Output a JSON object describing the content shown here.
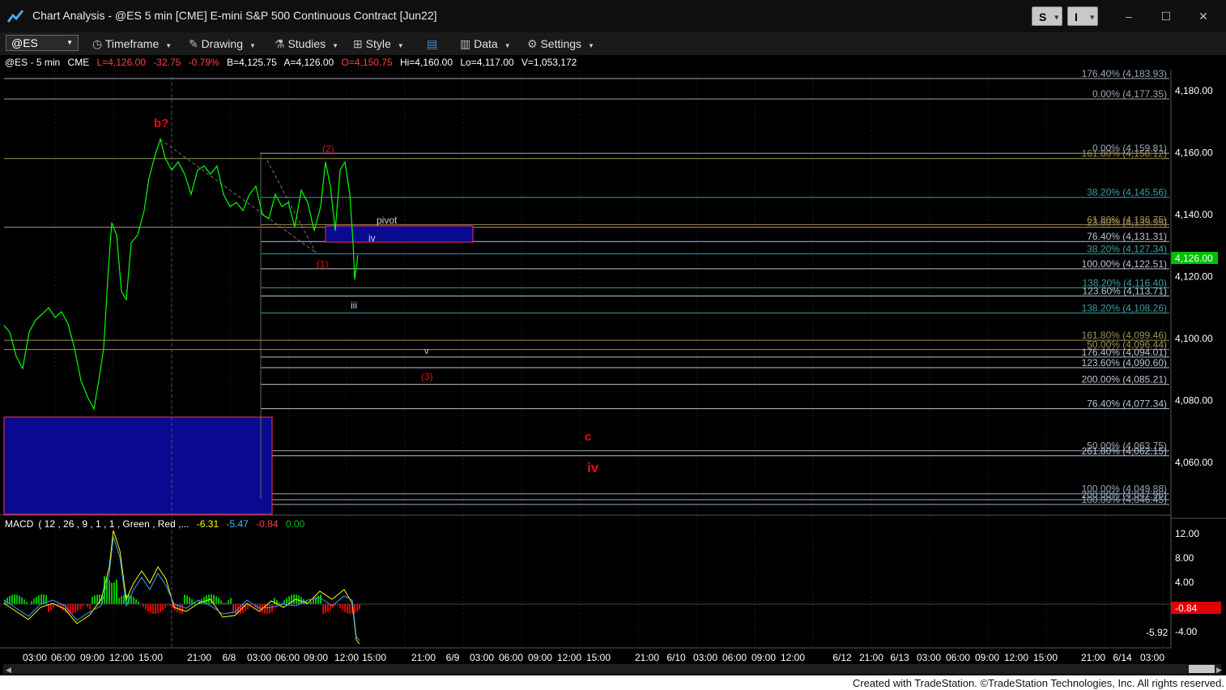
{
  "window": {
    "title": "Chart Analysis - @ES 5 min [CME] E-mini S&P 500 Continuous Contract [Jun22]",
    "btn_s": "S",
    "btn_i": "I",
    "minimize_icon": "minimize-icon",
    "maximize_icon": "maximize-icon",
    "close_icon": "close-icon"
  },
  "toolbar": {
    "symbol": "@ES",
    "timeframe": "Timeframe",
    "drawing": "Drawing",
    "studies": "Studies",
    "style": "Style",
    "data": "Data",
    "settings": "Settings"
  },
  "info": {
    "symbol": "@ES - 5 min",
    "exchange": "CME",
    "last": "L=4,126.00",
    "change": "-32.75",
    "pct": "-0.79%",
    "bid": "B=4,125.75",
    "ask": "A=4,126.00",
    "open": "O=4,150.75",
    "high": "Hi=4,160.00",
    "low": "Lo=4,117.00",
    "volume": "V=1,053,172"
  },
  "price_axis": {
    "labels": [
      "4,180.00",
      "4,160.00",
      "4,140.00",
      "4,120.00",
      "4,100.00",
      "4,080.00",
      "4,060.00"
    ],
    "current": "4,126.00",
    "current_color": "#00c000"
  },
  "fib_levels": [
    {
      "label": "176.40% (4,183.93)",
      "color": "#9aa8b8"
    },
    {
      "label": "0.00% (4,177.35)",
      "color": "#9aa8b8"
    },
    {
      "label": "0.00% (4,159.81)",
      "color": "#9aa8b8"
    },
    {
      "label": "161.80% (4,158.12)",
      "color": "#a09050"
    },
    {
      "label": "38.20% (4,145.56)",
      "color": "#3a9ea0"
    },
    {
      "label": "61.80% (4,136.75)",
      "color": "#a09050"
    },
    {
      "label": "23.60% (4,135.95)",
      "color": "#a09050"
    },
    {
      "label": "76.40% (4,131.31)",
      "color": "#b8c4d0"
    },
    {
      "label": "38.20% (4,127.34)",
      "color": "#3a9ea0"
    },
    {
      "label": "100.00% (4,122.51)",
      "color": "#b8c4d0"
    },
    {
      "label": "138.20% (4,116.40)",
      "color": "#3a9ea0"
    },
    {
      "label": "123.60% (4,113.71)",
      "color": "#b8c4d0"
    },
    {
      "label": "138.20% (4,108.26)",
      "color": "#3a9ea0"
    },
    {
      "label": "161.80% (4,099.46)",
      "color": "#a09050"
    },
    {
      "label": "50.00% (4,096.44)",
      "color": "#a09050"
    },
    {
      "label": "176.40% (4,094.01)",
      "color": "#b8c4d0"
    },
    {
      "label": "123.60% (4,090.60)",
      "color": "#b8c4d0"
    },
    {
      "label": "200.00% (4,085.21)",
      "color": "#b8c4d0"
    },
    {
      "label": "76.40% (4,077.34)",
      "color": "#b8c4d0"
    },
    {
      "label": "50.00% (4,063.75)",
      "color": "#9aa8b8"
    },
    {
      "label": "261.80% (4,062.15)",
      "color": "#b8c4d0"
    },
    {
      "label": "100.00% (4,049.88)",
      "color": "#9aa8b8"
    },
    {
      "label": "200.00% (4,047.96)",
      "color": "#9aa8b8"
    },
    {
      "label": "100.00% (4,046.45)",
      "color": "#9aa8b8"
    }
  ],
  "annotations": {
    "b": "b?",
    "w1": "(1)",
    "w2": "(2)",
    "w3": "(3)",
    "pivot": "pivot",
    "iv_small": "iv",
    "iii": "iii",
    "v": "v",
    "c": "c",
    "iv_big": "iv"
  },
  "macd": {
    "name": "MACD",
    "params": "( 12 , 26 , 9 , 1 , 1 , Green , Red ,...",
    "v1": "-6.31",
    "v2": "-5.47",
    "v3": "-0.84",
    "v4": "0.00",
    "axis": [
      "12.00",
      "8.00",
      "4.00",
      "-4.00"
    ],
    "current": "-0.84",
    "signal_value": "-5.92"
  },
  "time_axis": [
    "03:00",
    "06:00",
    "09:00",
    "12:00",
    "15:00",
    "21:00",
    "6/8",
    "03:00",
    "06:00",
    "09:00",
    "12:00",
    "15:00",
    "21:00",
    "6/9",
    "03:00",
    "06:00",
    "09:00",
    "12:00",
    "15:00",
    "21:00",
    "6/10",
    "03:00",
    "06:00",
    "09:00",
    "12:00",
    "6/12",
    "21:00",
    "6/13",
    "03:00",
    "06:00",
    "09:00",
    "12:00",
    "15:00",
    "21:00",
    "6/14",
    "03:00"
  ],
  "footer": "Created with TradeStation. ©TradeStation Technologies, Inc. All rights reserved."
}
